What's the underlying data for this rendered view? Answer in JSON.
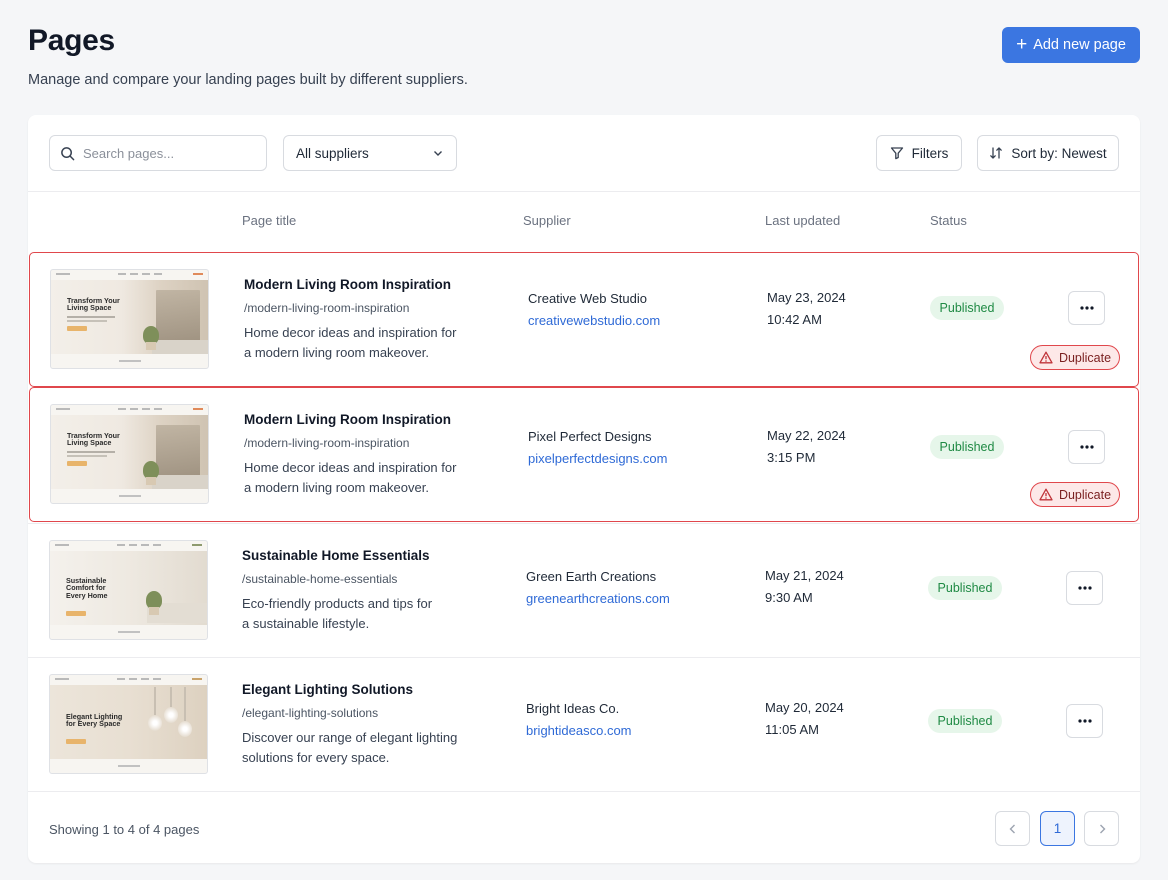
{
  "header": {
    "title": "Pages",
    "subtitle": "Manage and compare your landing pages built by different suppliers.",
    "add_button_label": "Add new page"
  },
  "toolbar": {
    "search_placeholder": "Search pages...",
    "supplier_select_value": "All suppliers",
    "filters_label": "Filters",
    "sort_label": "Sort by: Newest"
  },
  "table": {
    "columns": {
      "page_title": "Page title",
      "supplier": "Supplier",
      "last_updated": "Last updated",
      "status": "Status"
    },
    "rows": [
      {
        "title": "Modern Living Room Inspiration",
        "slug": "/modern-living-room-inspiration",
        "desc1": "Home decor ideas and inspiration for",
        "desc2": "a modern living room makeover.",
        "supplier": "Creative Web Studio",
        "supplier_url": "creativewebstudio.com",
        "date": "May 23, 2024",
        "time": "10:42 AM",
        "status": "Published",
        "flag": "Duplicate",
        "thumb_heading": "Transform Your Living Space"
      },
      {
        "title": "Modern Living Room Inspiration",
        "slug": "/modern-living-room-inspiration",
        "desc1": "Home decor ideas and inspiration for",
        "desc2": "a modern living room makeover.",
        "supplier": "Pixel Perfect Designs",
        "supplier_url": "pixelperfectdesigns.com",
        "date": "May 22, 2024",
        "time": "3:15 PM",
        "status": "Published",
        "flag": "Duplicate",
        "thumb_heading": "Transform Your Living Space"
      },
      {
        "title": "Sustainable Home Essentials",
        "slug": "/sustainable-home-essentials",
        "desc1": "Eco-friendly products and tips for",
        "desc2": "a sustainable lifestyle.",
        "supplier": "Green Earth Creations",
        "supplier_url": "greenearthcreations.com",
        "date": "May 21, 2024",
        "time": "9:30 AM",
        "status": "Published",
        "thumb_heading": "Sustainable Comfort for Every Home"
      },
      {
        "title": "Elegant Lighting Solutions",
        "slug": "/elegant-lighting-solutions",
        "desc1": "Discover our range of elegant lighting",
        "desc2": "solutions for every space.",
        "supplier": "Bright Ideas Co.",
        "supplier_url": "brightideasco.com",
        "date": "May 20, 2024",
        "time": "11:05 AM",
        "status": "Published",
        "thumb_heading": "Elegant Lighting for Every Space"
      }
    ]
  },
  "footer": {
    "showing_text": "Showing 1 to 4 of 4 pages",
    "current_page": "1"
  },
  "colors": {
    "accent": "#3b76e1",
    "duplicate_border": "#e0474c",
    "published_text": "#1f8a44",
    "published_bg": "#e6f6ea",
    "link": "#2f6ad6"
  }
}
